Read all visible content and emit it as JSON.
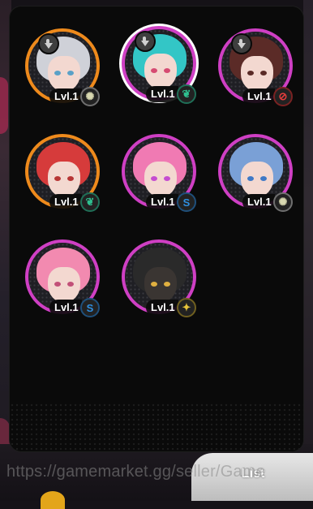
{
  "list_label": "List",
  "watermark": "https://gamemarket.gg/seller/Game",
  "characters": [
    {
      "level": "Lvl.1",
      "frame": "orange",
      "element_icon": "light-gear-icon",
      "badge": "down-arrow-icon",
      "hair": "#cfd1d8",
      "eye": "#5aa1c7",
      "selected": false
    },
    {
      "level": "Lvl.1",
      "frame": "purple",
      "element_icon": "wind-icon",
      "badge": "down-arrow-icon",
      "hair": "#33c6c6",
      "eye": "#d64b72",
      "selected": true
    },
    {
      "level": "Lvl.1",
      "frame": "purple",
      "element_icon": "fire-icon",
      "badge": "down-arrow-icon",
      "hair": "#5b2b27",
      "eye": "#5a2b27",
      "selected": false
    },
    {
      "level": "Lvl.1",
      "frame": "orange",
      "element_icon": "wind-icon",
      "badge": "",
      "hair": "#d63b3b",
      "eye": "#b73535",
      "selected": false
    },
    {
      "level": "Lvl.1",
      "frame": "purple",
      "element_icon": "water-icon",
      "badge": "",
      "hair": "#f07ab3",
      "eye": "#c54cd1",
      "selected": false
    },
    {
      "level": "Lvl.1",
      "frame": "purple",
      "element_icon": "light-gear-icon",
      "badge": "",
      "hair": "#7aa0d6",
      "eye": "#3f79c6",
      "selected": false
    },
    {
      "level": "Lvl.1",
      "frame": "purple",
      "element_icon": "water-icon",
      "badge": "",
      "hair": "#f28ab0",
      "eye": "#c25078",
      "selected": false
    },
    {
      "level": "Lvl.1",
      "frame": "purple",
      "element_icon": "star-icon",
      "badge": "",
      "hair": "#2a2a2a",
      "eye": "#e0b040",
      "selected": false
    }
  ]
}
